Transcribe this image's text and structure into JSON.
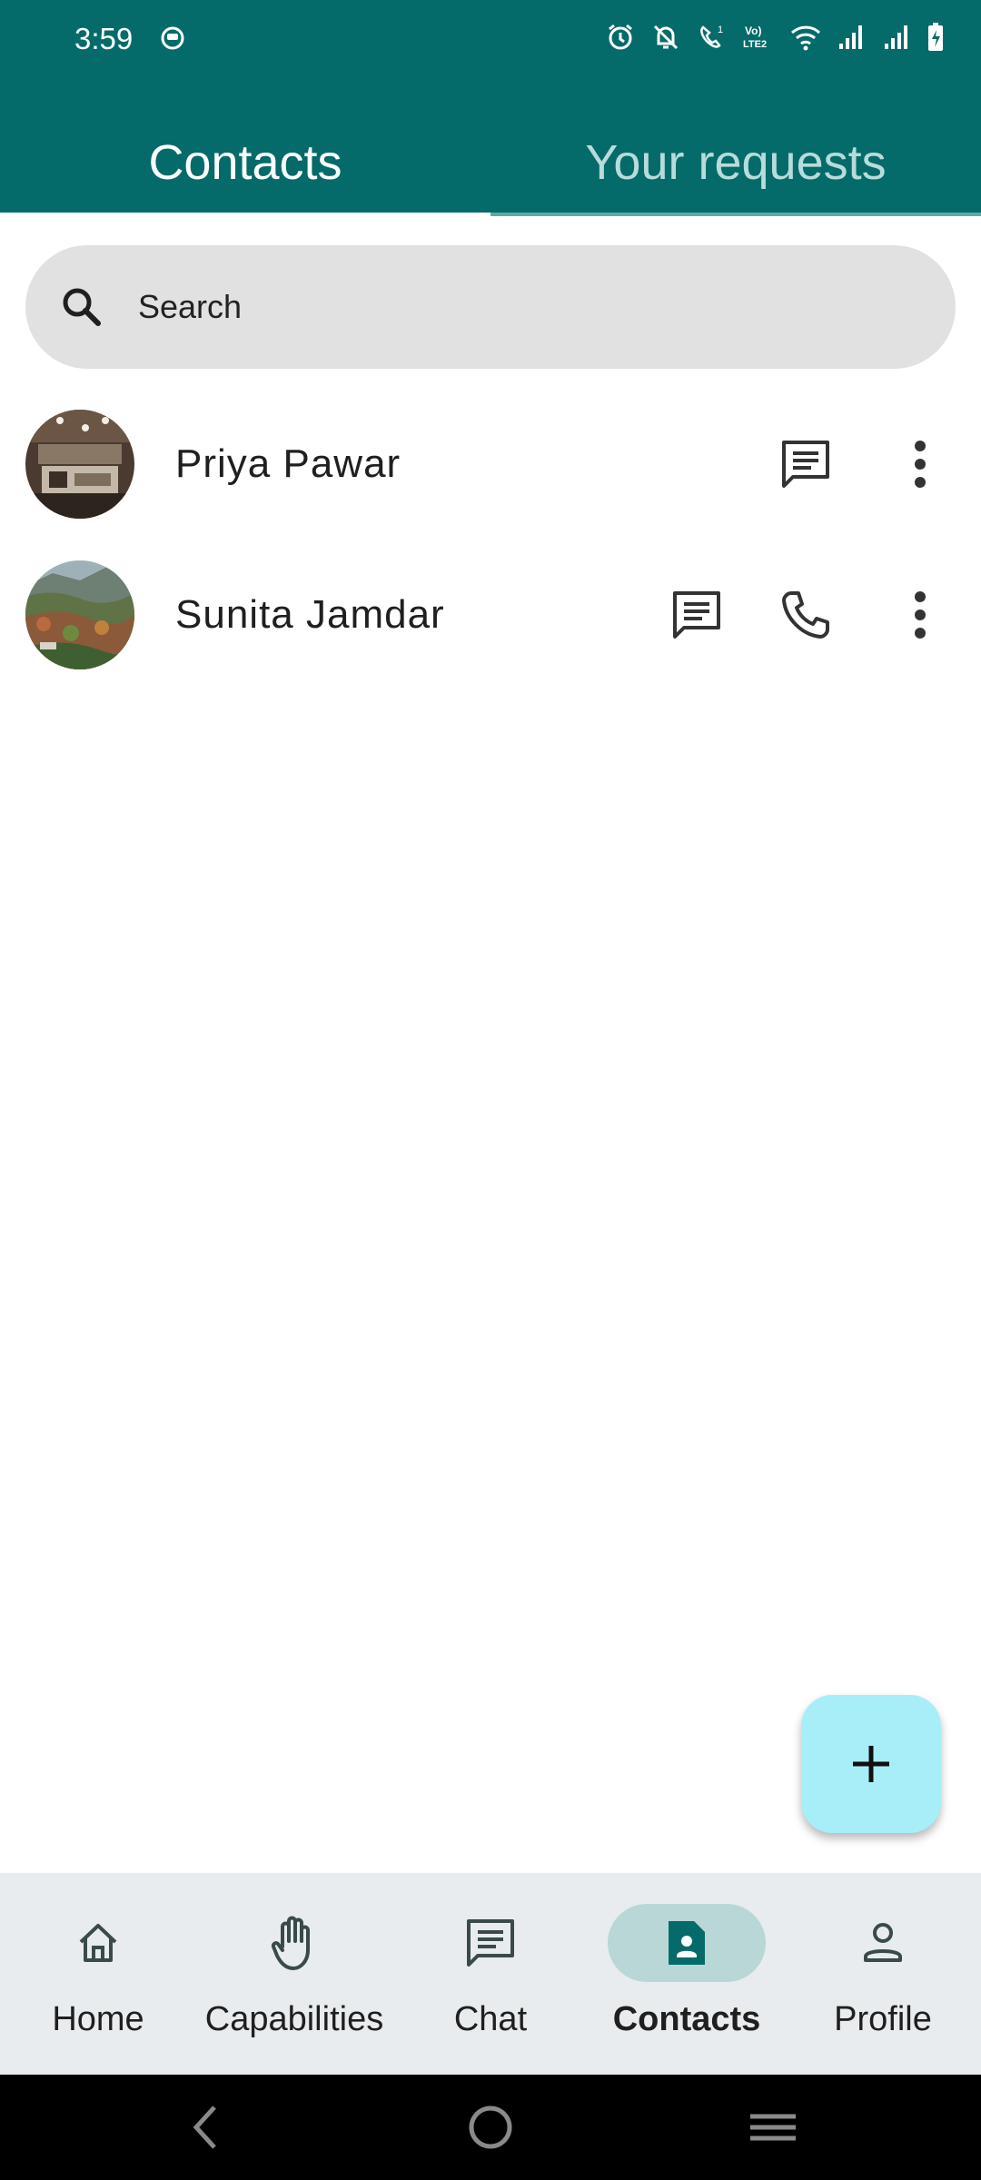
{
  "status_bar": {
    "time": "3:59"
  },
  "tabs": [
    {
      "label": "Contacts",
      "active": true
    },
    {
      "label": "Your requests",
      "active": false
    }
  ],
  "search": {
    "placeholder": "Search"
  },
  "contacts": [
    {
      "name": "Priya Pawar",
      "has_chat": true,
      "has_call": false
    },
    {
      "name": "Sunita Jamdar",
      "has_chat": true,
      "has_call": true
    }
  ],
  "fab": {
    "icon": "plus-icon"
  },
  "bottom_nav": [
    {
      "label": "Home",
      "icon": "home-icon",
      "active": false
    },
    {
      "label": "Capabilities",
      "icon": "hand-icon",
      "active": false
    },
    {
      "label": "Chat",
      "icon": "chat-icon",
      "active": false
    },
    {
      "label": "Contacts",
      "icon": "contact-card-icon",
      "active": true
    },
    {
      "label": "Profile",
      "icon": "person-icon",
      "active": false
    }
  ],
  "colors": {
    "header": "#046b6a",
    "fab": "#a8eef9",
    "nav_background": "#e8ecee",
    "active_pill": "#b9d7d6",
    "search_background": "#e1e1e1"
  }
}
